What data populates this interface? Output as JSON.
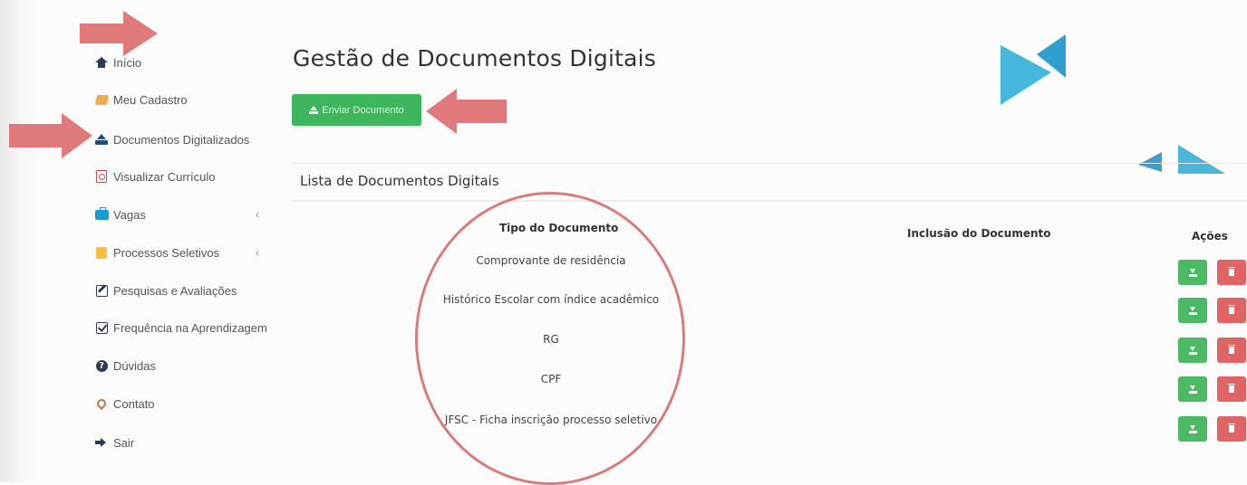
{
  "sidebar": {
    "items": [
      {
        "label": "Início",
        "icon": "home-icon"
      },
      {
        "label": "Meu Cadastro",
        "icon": "book-icon"
      },
      {
        "label": "Documentos Digitalizados",
        "icon": "upload-icon"
      },
      {
        "label": "Visualizar Currículo",
        "icon": "pdf-icon"
      },
      {
        "label": "Vagas",
        "icon": "briefcase-icon",
        "chevron": "‹"
      },
      {
        "label": "Processos Seletivos",
        "icon": "calendar-icon",
        "chevron": "‹"
      },
      {
        "label": "Pesquisas e Avaliações",
        "icon": "edit-icon"
      },
      {
        "label": "Frequência na Aprendizagem",
        "icon": "check-square-icon"
      },
      {
        "label": "Dúvidas",
        "icon": "question-circle-icon"
      },
      {
        "label": "Contato",
        "icon": "map-marker-icon"
      },
      {
        "label": "Sair",
        "icon": "sign-out-icon"
      }
    ]
  },
  "main": {
    "title": "Gestão de Documentos Digitais",
    "send_button": "Enviar Documento",
    "panel_title": "Lista de Documentos Digitais",
    "table": {
      "headers": {
        "type": "Tipo do Documento",
        "inclusion": "Inclusão do Documento",
        "actions": "Ações"
      },
      "rows": [
        {
          "type": "Comprovante de residência",
          "inclusion": ""
        },
        {
          "type": "Histórico Escolar com índice acadêmico",
          "inclusion": ""
        },
        {
          "type": "RG",
          "inclusion": ""
        },
        {
          "type": "CPF",
          "inclusion": ""
        },
        {
          "type": "JFSC - Ficha inscrição processo seletivo",
          "inclusion": ""
        }
      ]
    }
  },
  "colors": {
    "accent_green": "#3fb55e",
    "danger_red": "#e06464",
    "annotation_red": "#e07a7a",
    "logo_blue": "#3bb3d8"
  }
}
